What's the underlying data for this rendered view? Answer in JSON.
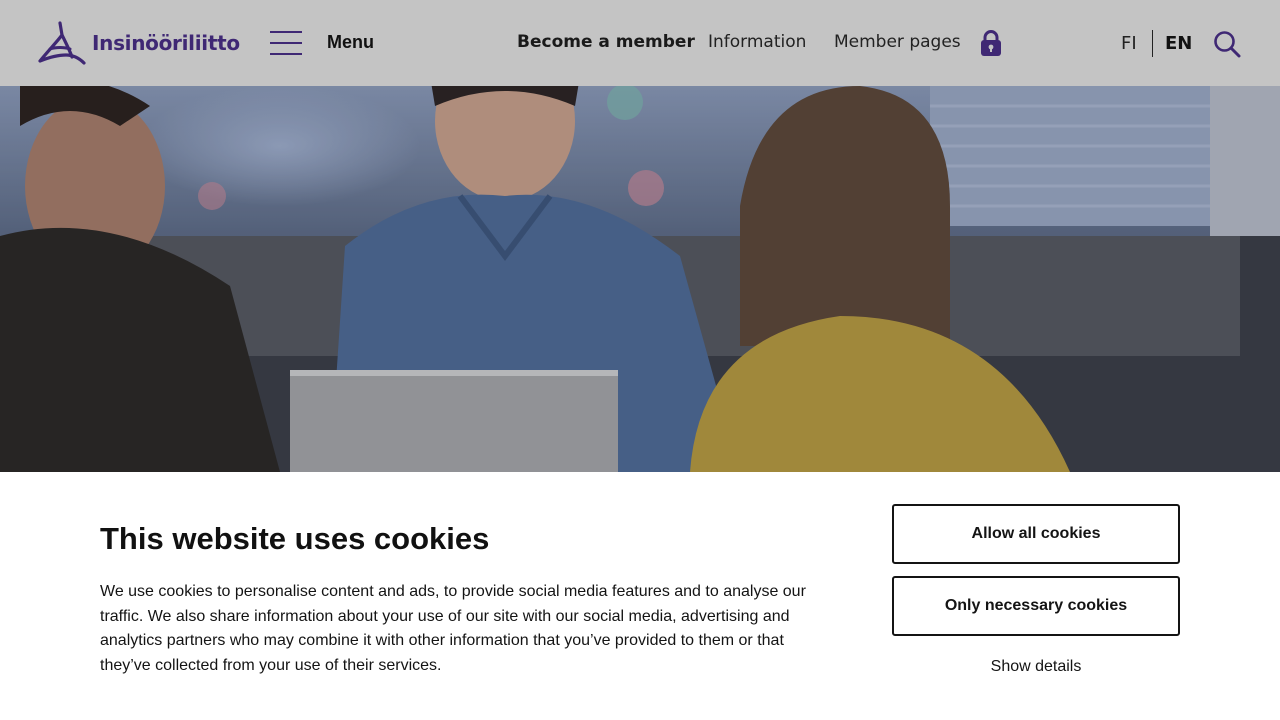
{
  "header": {
    "logo_text": "Insinööriliitto",
    "menu_label": "Menu",
    "nav": {
      "become_member": "Become a member",
      "information": "Information",
      "member_pages": "Member pages"
    },
    "languages": {
      "fi": "FI",
      "en": "EN"
    },
    "colors": {
      "background": "#c4c4c4",
      "brand": "#3f2874"
    }
  },
  "hero": {
    "image": "office-meeting-photo"
  },
  "cookie_banner": {
    "title": "This website uses cookies",
    "body": "We use cookies to personalise content and ads, to provide social media features and to analyse our traffic. We also share information about your use of our site with our social media, advertising and analytics partners who may combine it with other information that you’ve provided to them or that they’ve collected from your use of their services.",
    "allow_all": "Allow all cookies",
    "only_necessary": "Only necessary cookies",
    "show_details": "Show details"
  }
}
